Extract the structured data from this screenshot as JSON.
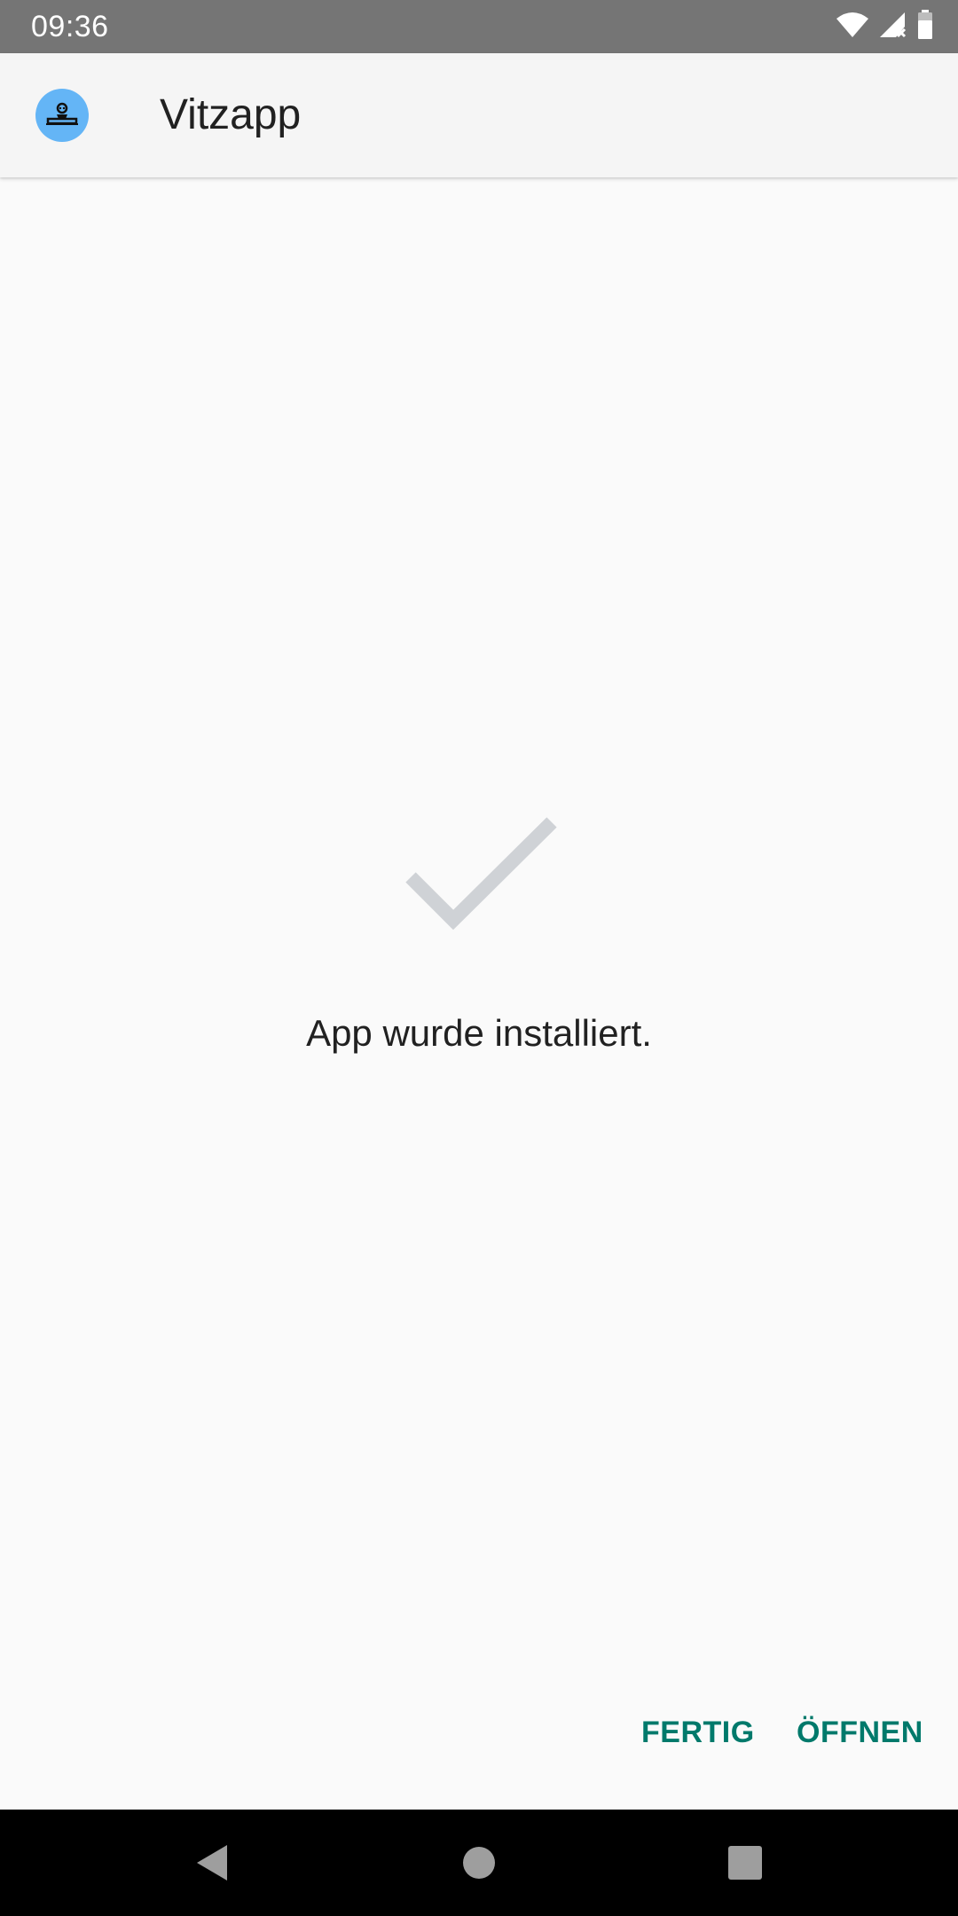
{
  "status_bar": {
    "time": "09:36",
    "icons": [
      "wifi-icon",
      "cellular-no-signal-icon",
      "battery-icon"
    ]
  },
  "app_bar": {
    "app_icon": "app-logo-icon",
    "title": "Vitzapp"
  },
  "content": {
    "status_icon": "checkmark-icon",
    "message": "App wurde installiert."
  },
  "actions": {
    "done_label": "FERTIG",
    "open_label": "ÖFFNEN"
  },
  "nav_bar": {
    "icons": [
      "back-icon",
      "home-icon",
      "recents-icon"
    ]
  },
  "colors": {
    "status_bar": "#757575",
    "app_bar": "#f5f5f5",
    "background": "#fafafa",
    "accent": "#00796b",
    "app_icon_bg": "#64b5f6",
    "checkmark": "#cfd2d6",
    "nav_bar": "#000000"
  }
}
